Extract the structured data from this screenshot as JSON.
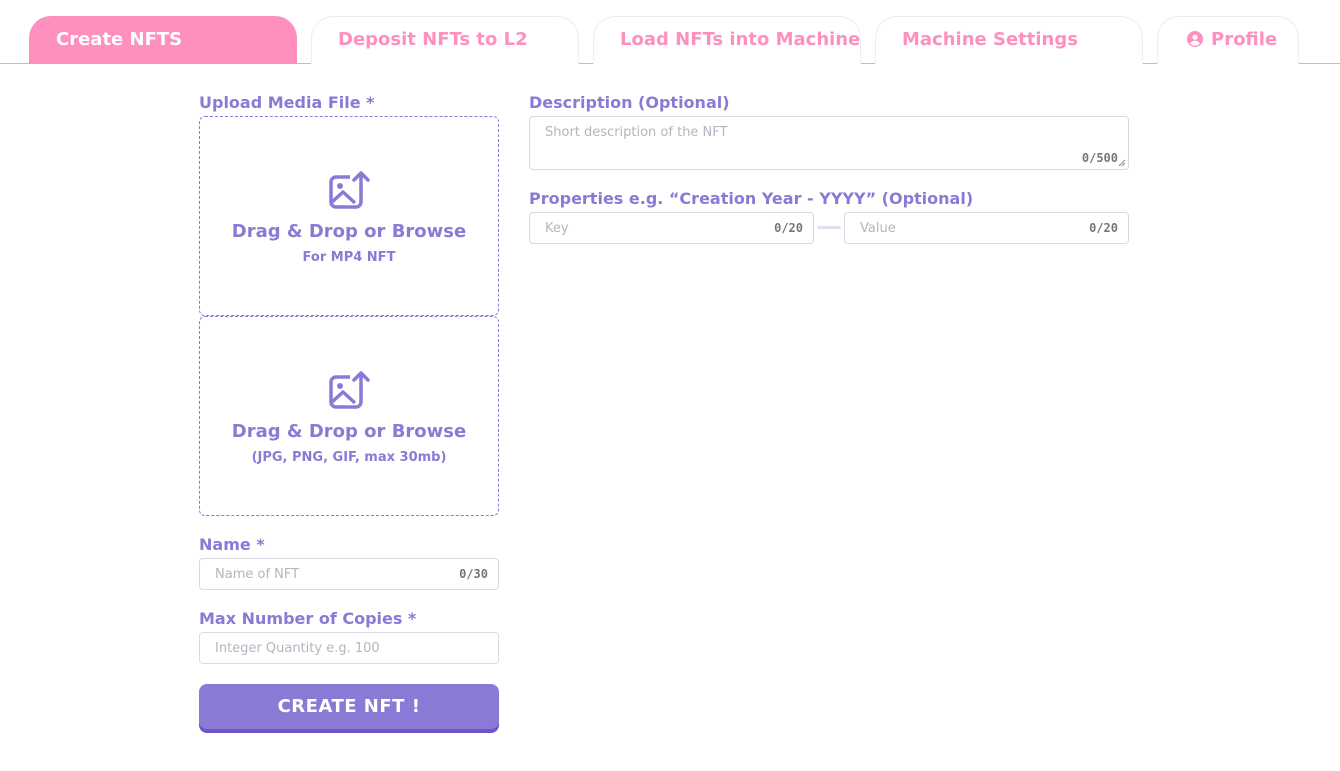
{
  "tabs": [
    {
      "label": "Create NFTS",
      "active": true
    },
    {
      "label": "Deposit NFTs to L2",
      "active": false
    },
    {
      "label": "Load NFTs into Machine",
      "active": false
    },
    {
      "label": "Machine Settings",
      "active": false
    },
    {
      "label": "Profile",
      "active": false,
      "icon": "user-circle-icon"
    }
  ],
  "form": {
    "upload_label": "Upload Media File *",
    "dropzone_mp4": {
      "title": "Drag & Drop or Browse",
      "subtitle": "For MP4 NFT",
      "icon": "image-upload-icon"
    },
    "dropzone_image": {
      "title": "Drag & Drop or Browse",
      "subtitle": "(JPG, PNG, GIF, max 30mb)",
      "icon": "image-upload-icon"
    },
    "name_label": "Name *",
    "name_placeholder": "Name of NFT",
    "name_counter": "0/30",
    "copies_label": "Max Number of Copies *",
    "copies_placeholder": "Integer Quantity e.g. 100",
    "description_label": "Description (Optional)",
    "description_placeholder": "Short description of the NFT",
    "description_counter": "0/500",
    "properties_label": "Properties e.g. “Creation Year - YYYY” (Optional)",
    "key_placeholder": "Key",
    "key_counter": "0/20",
    "value_placeholder": "Value",
    "value_counter": "0/20",
    "create_button": "CREATE NFT !"
  },
  "colors": {
    "accent_pink": "#ff8fbf",
    "accent_purple": "#8a7ad6",
    "button_shadow": "#6d56c9"
  }
}
